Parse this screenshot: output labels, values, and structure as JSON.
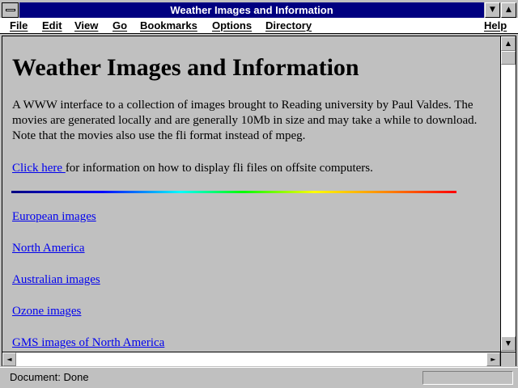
{
  "window": {
    "title": "Weather Images and Information",
    "minimize_glyph": "▼",
    "maximize_glyph": "▲"
  },
  "menubar": {
    "items": [
      "File",
      "Edit",
      "View",
      "Go",
      "Bookmarks",
      "Options",
      "Directory"
    ],
    "help": "Help"
  },
  "page": {
    "heading": "Weather Images and Information",
    "intro": "A WWW interface to a collection of images brought to Reading university by Paul Valdes. The movies are generated locally and are generally 10Mb in size and may take a while to download. Note that the movies also use the fli format instead of mpeg.",
    "click_here": "Click here ",
    "click_here_rest": "for information on how to display fli files on offsite computers.",
    "links": [
      "European images",
      "North America",
      "Australian images",
      "Ozone images",
      "GMS images of North America"
    ]
  },
  "scrollbars": {
    "up": "▲",
    "down": "▼",
    "left": "◄",
    "right": "►"
  },
  "status": {
    "text": "Document: Done",
    "progress": 0
  },
  "colors": {
    "titlebar": "#000080",
    "chrome": "#c0c0c0",
    "link": "#0000ee"
  }
}
